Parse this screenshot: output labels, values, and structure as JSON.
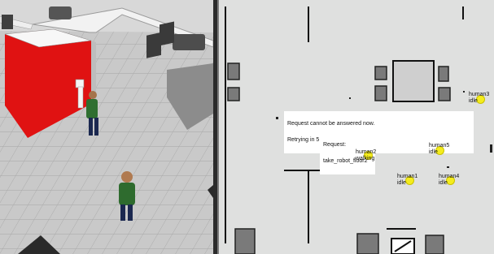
{
  "request_notice": {
    "line1": "Request   cannot   be   answered   now.",
    "line2": "Retrying   in   5   sec..."
  },
  "request": {
    "line1": "Request:",
    "line2": "take_robot_floor2"
  },
  "humans": [
    {
      "name": "human1",
      "status": "idle"
    },
    {
      "name": "human2",
      "status": "walking"
    },
    {
      "name": "human3",
      "status": "idle"
    },
    {
      "name": "human4",
      "status": "idle"
    },
    {
      "name": "human5",
      "status": "idle"
    }
  ],
  "colors": {
    "human_marker": "#f4ec1d",
    "map_free": "#dfe0df",
    "map_obstacle": "#111111",
    "sim_wall_red": "#e01010",
    "sim_floor": "#c8c8c8"
  },
  "icons": {
    "human_marker": "filled-circle",
    "robot": "white-robot-model"
  }
}
